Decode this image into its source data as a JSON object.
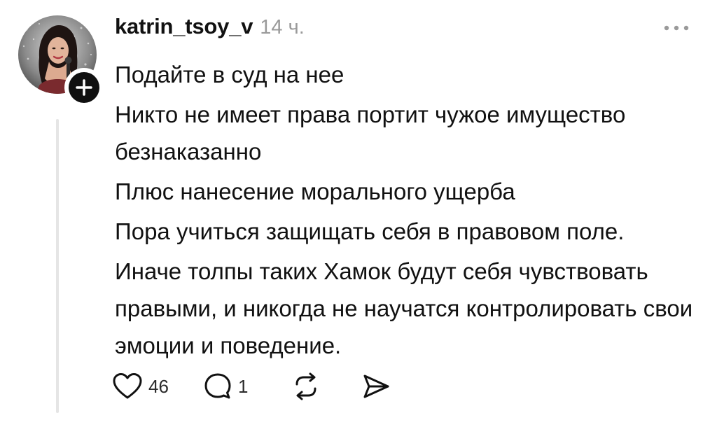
{
  "post": {
    "author": "katrin_tsoy_v",
    "time": "14 ч.",
    "paragraphs": [
      "Подайте в суд на нее",
      "Никто не имеет права портит чужое имущество безнаказанно",
      "Плюс нанесение морального ущерба",
      "Пора учиться защищать себя в правовом поле.",
      "Иначе толпы таких Хамок будут себя чувствовать правыми, и никогда не научатся контролировать свои эмоции и поведение."
    ],
    "likes": "46",
    "replies": "1"
  },
  "icons": {
    "more": "more-horizontal-icon",
    "follow": "plus-icon",
    "like": "heart-icon",
    "reply": "speech-bubble-icon",
    "repost": "repost-icon",
    "share": "send-icon"
  },
  "colors": {
    "text": "#111111",
    "muted": "#9a9a9a",
    "thread_line": "#e5e5e5",
    "badge": "#101010"
  }
}
